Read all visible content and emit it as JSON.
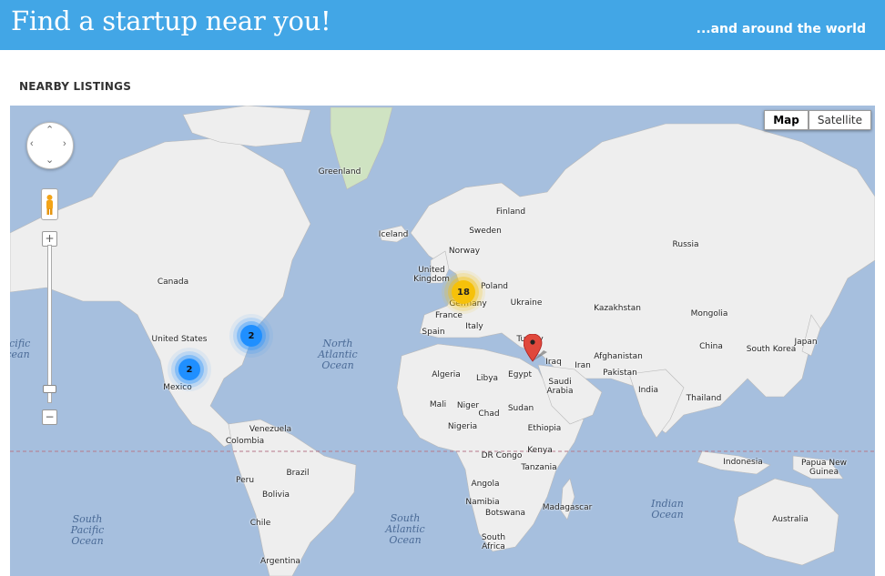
{
  "header": {
    "title": "Find a startup near you!",
    "tagline": "...and around the world",
    "background": "#42a6e6"
  },
  "section": {
    "heading": "NEARBY LISTINGS"
  },
  "map": {
    "map_type_options": [
      "Map",
      "Satellite"
    ],
    "selected_map_type": "Map",
    "controls": {
      "zoom_in": "+",
      "zoom_out": "−",
      "icons": [
        "pan-control-icon",
        "pegman-icon",
        "zoom-slider-icon"
      ]
    },
    "ocean_colour": "#a6bfde",
    "land_colour": "#eeeeee",
    "country_labels": [
      "Greenland",
      "Iceland",
      "Finland",
      "Sweden",
      "Norway",
      "United Kingdom",
      "Poland",
      "Germany",
      "France",
      "Ukraine",
      "Spain",
      "Italy",
      "Turkey",
      "Kazakhstan",
      "Russia",
      "Mongolia",
      "China",
      "South Korea",
      "Japan",
      "Afghanistan",
      "Iran",
      "Iraq",
      "Pakistan",
      "India",
      "Thailand",
      "Canada",
      "United States",
      "Mexico",
      "Algeria",
      "Libya",
      "Egypt",
      "Saudi Arabia",
      "Mali",
      "Niger",
      "Chad",
      "Sudan",
      "Nigeria",
      "Ethiopia",
      "Kenya",
      "DR Congo",
      "Tanzania",
      "Angola",
      "Namibia",
      "Botswana",
      "Madagascar",
      "South Africa",
      "Venezuela",
      "Colombia",
      "Peru",
      "Brazil",
      "Bolivia",
      "Chile",
      "Argentina",
      "Indonesia",
      "Papua New Guinea",
      "Australia"
    ],
    "ocean_labels": [
      "North Atlantic Ocean",
      "South Atlantic Ocean",
      "South Pacific Ocean",
      "Indian Ocean",
      "Pacific Ocean"
    ],
    "clusters": [
      {
        "count": "2",
        "colour": "#1f8fff",
        "near": "United States east coast"
      },
      {
        "count": "2",
        "colour": "#1f8fff",
        "near": "Mexico"
      },
      {
        "count": "18",
        "colour": "#f6c10a",
        "near": "Germany"
      }
    ],
    "marker": {
      "icon": "map-pin-icon",
      "colour": "#e0483c",
      "near": "Turkey"
    }
  }
}
